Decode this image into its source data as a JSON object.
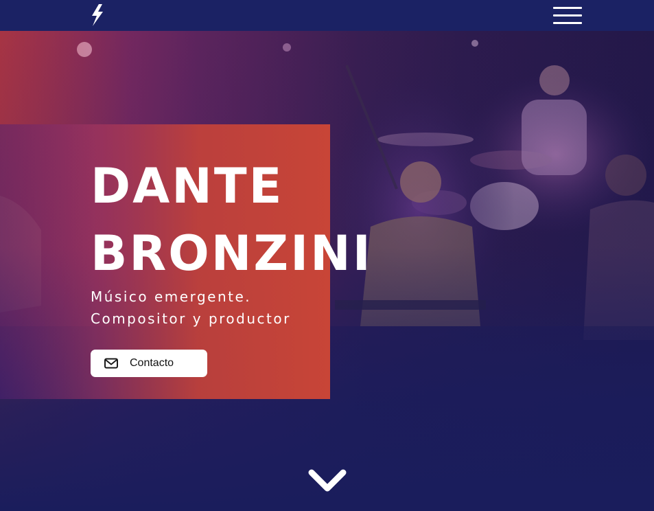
{
  "navbar": {
    "logo_icon": "lightning-bolt-icon",
    "menu_icon": "hamburger-menu-icon",
    "background": "#1b2264"
  },
  "hero": {
    "title_line_1": "DANTE",
    "title_line_2": "BRONZINI",
    "subtitle_line_1": "Músico emergente.",
    "subtitle_line_2": "Compositor y productor",
    "contact_button": {
      "label": "Contacto",
      "icon": "envelope-icon"
    },
    "scroll_icon": "chevron-down-icon",
    "accent_color": "#c84537",
    "overlay_color": "#1a1d5c"
  }
}
